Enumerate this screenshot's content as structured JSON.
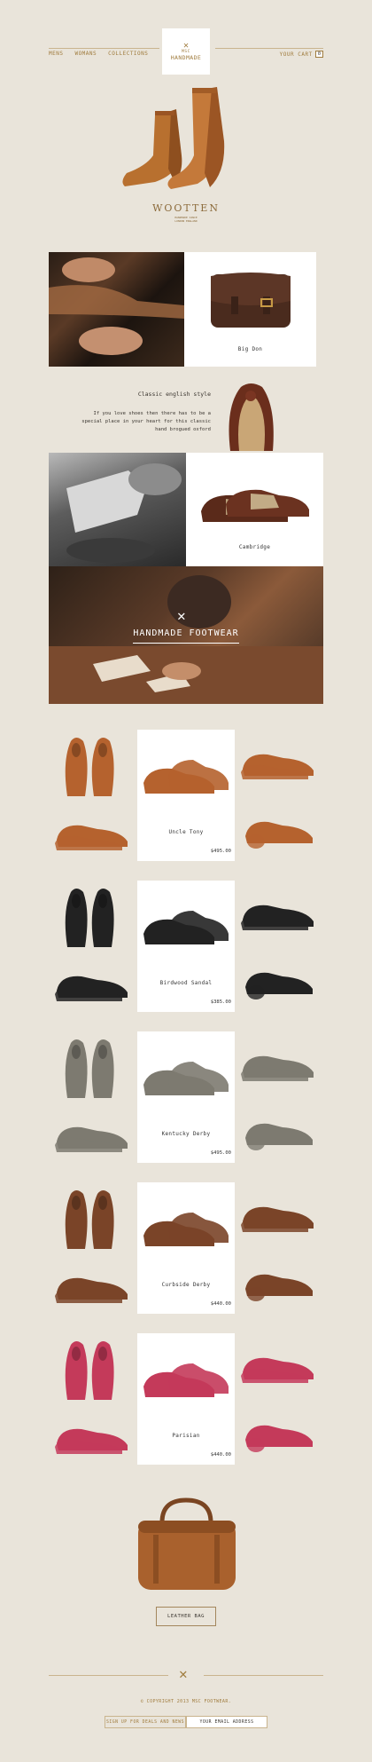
{
  "header": {
    "nav_left": [
      "MENS",
      "WOMANS",
      "COLLECTIONS"
    ],
    "logo_top": "MSC",
    "logo_main": "HANDMADE",
    "cart_label": "YOUR CART",
    "cart_count": "0"
  },
  "hero": {
    "brand": "WOOTTEN",
    "brand_sub1": "HANDMADE SINCE",
    "brand_sub2": "LONDON ENGLAND"
  },
  "featured": {
    "bag_name": "Big Don",
    "classic_title": "Classic english style",
    "classic_text": [
      "If you love shoes then there has to be a",
      "special place in your heart for this classic",
      "hand brogued oxford"
    ],
    "cambridge_name": "Cambridge",
    "banner_text": "HANDMADE FOOTWEAR"
  },
  "products": [
    {
      "name": "Uncle Tony",
      "price": "$495.00",
      "color": "#b5622e"
    },
    {
      "name": "Birdwood Sandal",
      "price": "$385.00",
      "color": "#222222"
    },
    {
      "name": "Kentucky Derby",
      "price": "$495.00",
      "color": "#7d7a70"
    },
    {
      "name": "Curbside Derby",
      "price": "$440.00",
      "color": "#7a4428"
    },
    {
      "name": "Parisian",
      "price": "$440.00",
      "color": "#c43a5a"
    }
  ],
  "bag_section": {
    "button_label": "LEATHER BAG"
  },
  "footer": {
    "copyright": "© COPYRIGHT 2013 MSC FOOTWEAR.",
    "signup_label": "SIGN UP FOR DEALS AND NEWS",
    "email_placeholder": "YOUR EMAIL ADDRESS"
  },
  "colors": {
    "background": "#e9e4da",
    "accent": "#a07c3e",
    "leather": "#b06a2e"
  }
}
